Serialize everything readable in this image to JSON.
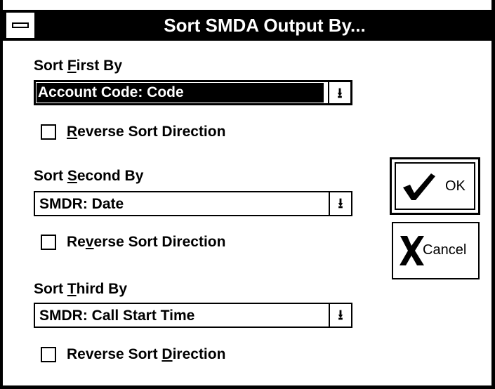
{
  "window": {
    "title": "Sort SMDA Output By..."
  },
  "sort_first": {
    "label_pre": "Sort ",
    "label_ul": "F",
    "label_post": "irst By",
    "value": "Account Code:  Code",
    "checkbox": {
      "pre": "",
      "ul": "R",
      "post": "everse Sort Direction",
      "checked": false
    }
  },
  "sort_second": {
    "label_pre": "Sort ",
    "label_ul": "S",
    "label_post": "econd By",
    "value": "SMDR:  Date",
    "checkbox": {
      "pre": "Re",
      "ul": "v",
      "post": "erse Sort Direction",
      "checked": false
    }
  },
  "sort_third": {
    "label_pre": "Sort ",
    "label_ul": "T",
    "label_post": "hird By",
    "value": "SMDR:  Call Start Time",
    "checkbox": {
      "pre": "Reverse Sort ",
      "ul": "D",
      "post": "irection",
      "checked": false
    }
  },
  "buttons": {
    "ok_label": "OK",
    "cancel_label": "Cancel"
  },
  "icons": {
    "dropdown": "down-arrow-icon",
    "ok": "checkmark-icon",
    "cancel": "x-icon",
    "system_menu": "system-menu-icon"
  }
}
